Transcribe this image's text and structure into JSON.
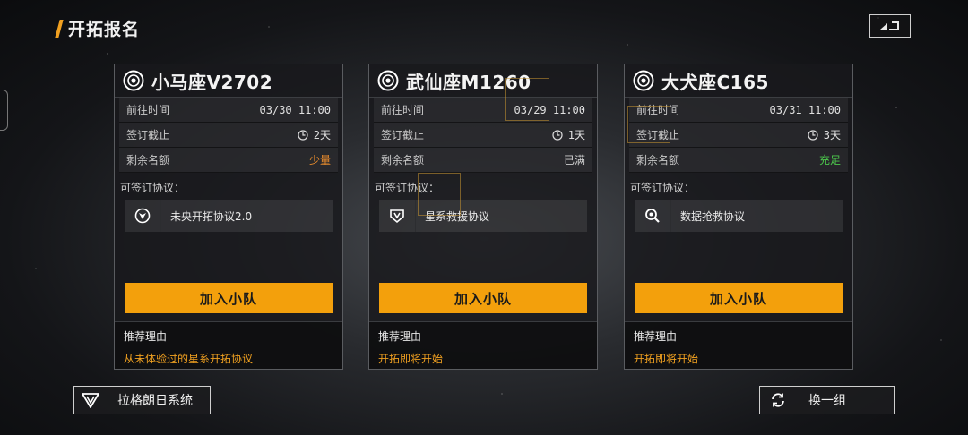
{
  "header": {
    "title": "开拓报名"
  },
  "cards": [
    {
      "planet_name": "小马座V2702",
      "rows": {
        "depart_label": "前往时间",
        "depart_value": "03/30 11:00",
        "deadline_label": "签订截止",
        "deadline_value": "2天",
        "quota_label": "剩余名额",
        "quota_value": "少量"
      },
      "protocol_label": "可签订协议：",
      "protocol_name": "未央开拓协议2.0",
      "protocol_icon": "shield-emblem-icon",
      "join_label": "加入小队",
      "reason_label": "推荐理由",
      "reason_text": "从未体验过的星系开拓协议"
    },
    {
      "planet_name": "武仙座M1260",
      "rows": {
        "depart_label": "前往时间",
        "depart_value": "03/29 11:00",
        "deadline_label": "签订截止",
        "deadline_value": "1天",
        "quota_label": "剩余名额",
        "quota_value": "已满"
      },
      "protocol_label": "可签订协议：",
      "protocol_name": "星系救援协议",
      "protocol_icon": "rescue-shield-icon",
      "join_label": "加入小队",
      "reason_label": "推荐理由",
      "reason_text": "开拓即将开始"
    },
    {
      "planet_name": "大犬座C165",
      "rows": {
        "depart_label": "前往时间",
        "depart_value": "03/31 11:00",
        "deadline_label": "签订截止",
        "deadline_value": "3天",
        "quota_label": "剩余名额",
        "quota_value": "充足"
      },
      "protocol_label": "可签订协议：",
      "protocol_name": "数据抢救协议",
      "protocol_icon": "magnifier-icon",
      "join_label": "加入小队",
      "reason_label": "推荐理由",
      "reason_text": "开拓即将开始"
    }
  ],
  "footer": {
    "system_label": "拉格朗日系统",
    "refresh_label": "换一组"
  },
  "colors": {
    "accent": "#f3a00c",
    "quota_low": "#e2882c",
    "quota_plenty": "#4cc64c"
  }
}
